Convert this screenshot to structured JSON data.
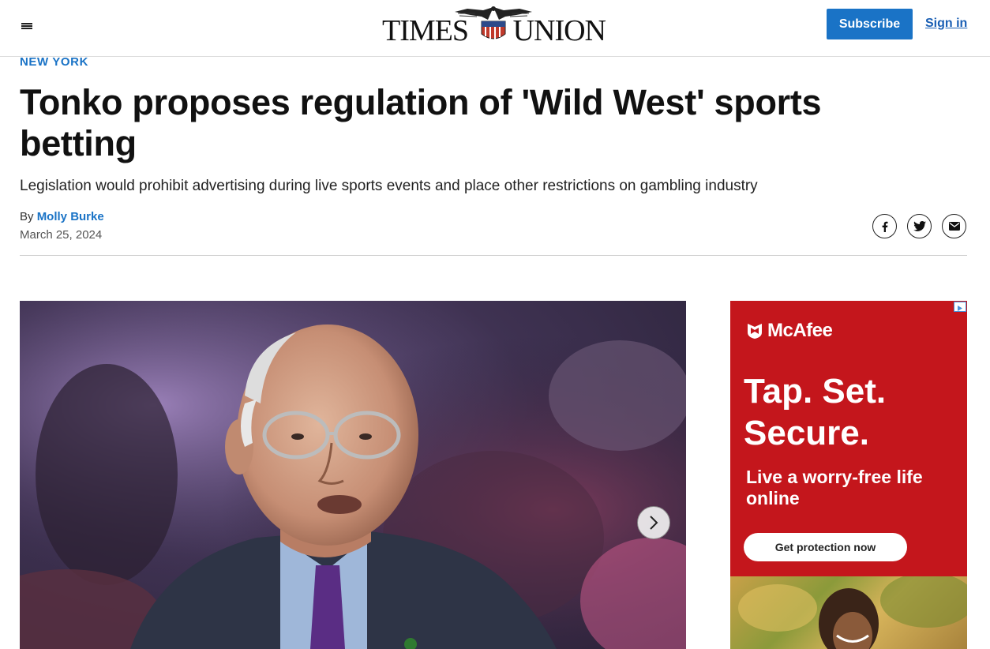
{
  "header": {
    "logo_left": "TIMES",
    "logo_right": "UNION",
    "subscribe_label": "Subscribe",
    "signin_label": "Sign in"
  },
  "article": {
    "section": "NEW YORK",
    "headline": "Tonko proposes regulation of 'Wild West' sports betting",
    "dek": "Legislation would prohibit advertising during live sports events and place other restrictions on gambling industry",
    "byline_prefix": "By ",
    "author": "Molly Burke",
    "date": "March 25, 2024"
  },
  "share": {
    "facebook_icon": "facebook-icon",
    "twitter_icon": "twitter-icon",
    "email_icon": "email-icon"
  },
  "gallery": {
    "next_icon": "chevron-right-icon"
  },
  "ad": {
    "brand": "McAfee",
    "headline": "Tap. Set. Secure.",
    "subhead": "Live a worry-free life online",
    "cta": "Get protection now"
  },
  "colors": {
    "accent_blue": "#1a73c6",
    "ad_red": "#c4161c"
  }
}
